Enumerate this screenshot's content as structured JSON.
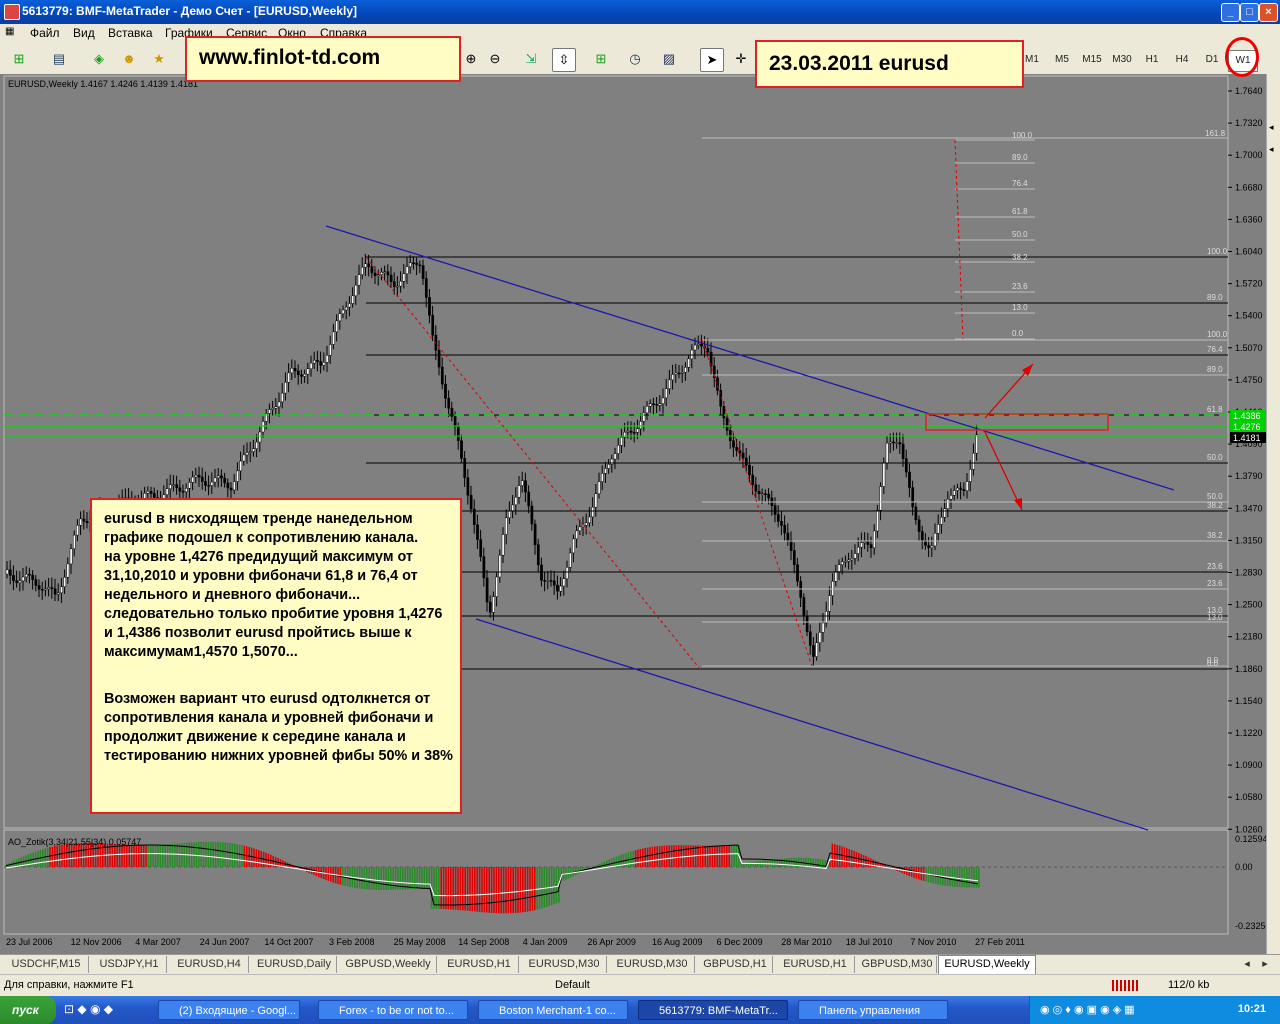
{
  "window": {
    "title": "5613779: BMF-MetaTrader - Демо Счет - [EURUSD,Weekly]"
  },
  "menu": [
    "Файл",
    "Вид",
    "Вставка",
    "Графики",
    "Сервис",
    "Окно",
    "Справка"
  ],
  "timeframes": [
    "M1",
    "M5",
    "M15",
    "M30",
    "H1",
    "H4",
    "D1",
    "W1"
  ],
  "active_timeframe": "W1",
  "annotations": {
    "site": "www.finlot-td.com",
    "date": "23.03.2011 eurusd",
    "text1": "eurusd в нисходящем тренде нанедельном графике  подошел к сопротивлению канала.\nна уровне 1,4276 предидущий максимум от 31,10,2010 и уровни фибоначи 61,8 и 76,4 от недельного и дневного фибоначи...\nследовательно   только пробитие уровня 1,4276 и 1,4386 позволит  eurusd пройтись выше к максимумам1,4570 1,5070...",
    "text2": "Возможен вариант  что  eurusd одтолкнется от сопротивления канала и уровней фибоначи и продолжит движение к середине канала и тестированию нижних уровней  фибы 50% и 38%"
  },
  "chart": {
    "symbol_info": "EURUSD,Weekly  1.4167 1.4246 1.4139 1.4181",
    "indicator_label": "AO_Zotik(3,34|21,55|34) 0.05747",
    "price_ticks": [
      "1.7640",
      "1.7320",
      "1.7000",
      "1.6680",
      "1.6360",
      "1.6040",
      "1.5720",
      "1.5400",
      "1.5070",
      "1.4750",
      "1.4410",
      "1.4090",
      "1.3790",
      "1.3470",
      "1.3150",
      "1.2830",
      "1.2500",
      "1.2180",
      "1.1860",
      "1.1540",
      "1.1220",
      "1.0900",
      "1.0580",
      "1.0260"
    ],
    "indicator_ticks": [
      "0.12594",
      "0.00",
      "-0.23250"
    ],
    "date_ticks": [
      "23 Jul 2006",
      "12 Nov 2006",
      "4 Mar 2007",
      "24 Jun 2007",
      "14 Oct 2007",
      "3 Feb 2008",
      "25 May 2008",
      "14 Sep 2008",
      "4 Jan 2009",
      "26 Apr 2009",
      "16 Aug 2009",
      "6 Dec 2009",
      "28 Mar 2010",
      "18 Jul 2010",
      "7 Nov 2010",
      "27 Feb 2011"
    ],
    "price_labels": {
      "green1": "1.4386",
      "green2": "1.4276",
      "current": "1.4181"
    },
    "fib_small": [
      "100.0",
      "89.0",
      "76.4",
      "61.8",
      "50.0",
      "38.2",
      "23.6",
      "13.0",
      "0.0"
    ],
    "fib_top_right": "161.8",
    "fib_right": [
      "100.0",
      "89.0",
      "76.4",
      "61.8",
      "50.0",
      "38.2",
      "23.6",
      "13.0",
      "0.0"
    ],
    "fib_mid": [
      "100.0",
      "89.0",
      "50.0",
      "38.2",
      "23.6",
      "13.0",
      "0.0"
    ]
  },
  "tabs": [
    "USDCHF,M15",
    "USDJPY,H1",
    "EURUSD,H4",
    "EURUSD,Daily",
    "GBPUSD,Weekly",
    "EURUSD,H1",
    "EURUSD,M30",
    "EURUSD,M30",
    "GBPUSD,H1",
    "EURUSD,H1",
    "GBPUSD,M30",
    "EURUSD,Weekly"
  ],
  "active_tab": "EURUSD,Weekly",
  "status": {
    "help": "Для справки, нажмите F1",
    "profile": "Default",
    "traffic": "112/0 kb"
  },
  "taskbar": {
    "start": "пуск",
    "items": [
      "(2) Входящие - Googl...",
      "Forex - to be or not to...",
      "Boston Merchant-1 co...",
      "5613779: BMF-MetaTr...",
      "Панель управления"
    ],
    "lang": "RU",
    "clock": "10:21"
  },
  "colors": {
    "chart_bg": "#808080",
    "channel": "#1a1aa8",
    "green_line": "#00e000",
    "fib": "#000000"
  }
}
